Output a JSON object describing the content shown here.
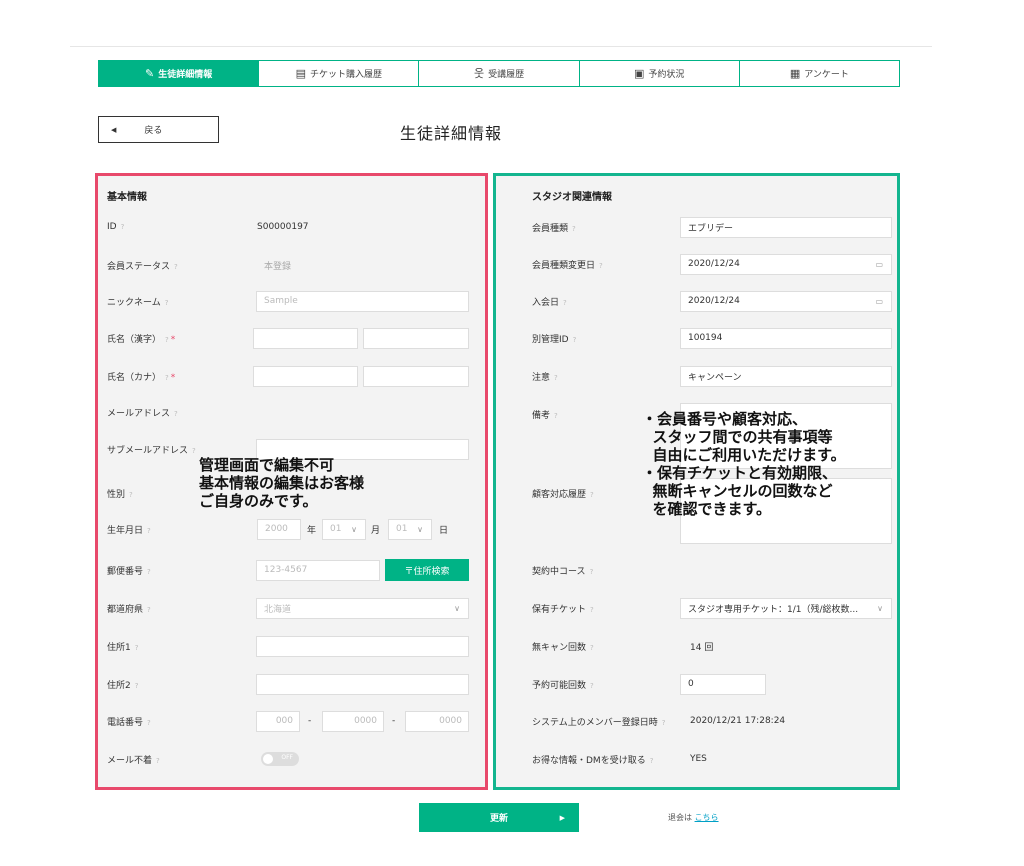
{
  "tabs": [
    {
      "label": "生徒詳細情報",
      "icon": "edit-icon"
    },
    {
      "label": "チケット購入履歴",
      "icon": "ticket-icon"
    },
    {
      "label": "受講履歴",
      "icon": "person-icon"
    },
    {
      "label": "予約状況",
      "icon": "reservation-icon"
    },
    {
      "label": "アンケート",
      "icon": "calendar-icon"
    }
  ],
  "back_label": "戻る",
  "page_title": "生徒詳細情報",
  "basic": {
    "title": "基本情報",
    "id_label": "ID",
    "id_value": "S00000197",
    "status_label": "会員ステータス",
    "status_value": "本登録",
    "nickname_label": "ニックネーム",
    "nickname_placeholder": "Sample",
    "name_kanji_label": "氏名（漢字）",
    "name_kana_label": "氏名（カナ）",
    "required_mark": "*",
    "email_label": "メールアドレス",
    "sub_email_label": "サブメールアドレス",
    "gender_label": "性別",
    "birth_label": "生年月日",
    "birth_year": "2000",
    "birth_year_unit": "年",
    "birth_month": "01",
    "birth_month_unit": "月",
    "birth_day": "01",
    "birth_day_unit": "日",
    "zip_label": "郵便番号",
    "zip_placeholder": "123-4567",
    "zip_button": "〒住所検索",
    "pref_label": "都道府県",
    "pref_value": "北海道",
    "addr1_label": "住所1",
    "addr2_label": "住所2",
    "phone_label": "電話番号",
    "phone_1": "000",
    "phone_2": "0000",
    "phone_3": "0000",
    "phone_sep": "-",
    "mail_off_label": "メール不着",
    "toggle_text": "OFF"
  },
  "studio": {
    "title": "スタジオ関連情報",
    "member_type_label": "会員種類",
    "member_type_value": "エブリデー",
    "type_change_label": "会員種類変更日",
    "type_change_value": "2020/12/24",
    "join_label": "入会日",
    "join_value": "2020/12/24",
    "alt_id_label": "別管理ID",
    "alt_id_value": "100194",
    "caution_label": "注意",
    "caution_value": "キャンペーン",
    "remarks_label": "備考",
    "history_label": "顧客対応履歴",
    "course_label": "契約中コース",
    "ticket_label": "保有チケット",
    "ticket_value": "スタジオ専用チケット：1/1（残/総枚数...",
    "nocancel_label": "無キャン回数",
    "nocancel_value": "14 回",
    "reservable_label": "予約可能回数",
    "reservable_value": "0",
    "registered_label": "システム上のメンバー登録日時",
    "registered_value": "2020/12/21 17:28:24",
    "dm_label": "お得な情報・DMを受け取る",
    "dm_value": "YES"
  },
  "annotations": {
    "left": "管理画面で編集不可\n基本情報の編集はお客様\nご自身のみです。",
    "right": "・会員番号や顧客対応、\n  スタッフ間での共有事項等\n  自由にご利用いただけます。\n・保有チケットと有効期限、\n  無断キャンセルの回数など\n  を確認できます。"
  },
  "footer": {
    "update_label": "更新",
    "quit_text": "退会は",
    "quit_link": "こちら"
  }
}
